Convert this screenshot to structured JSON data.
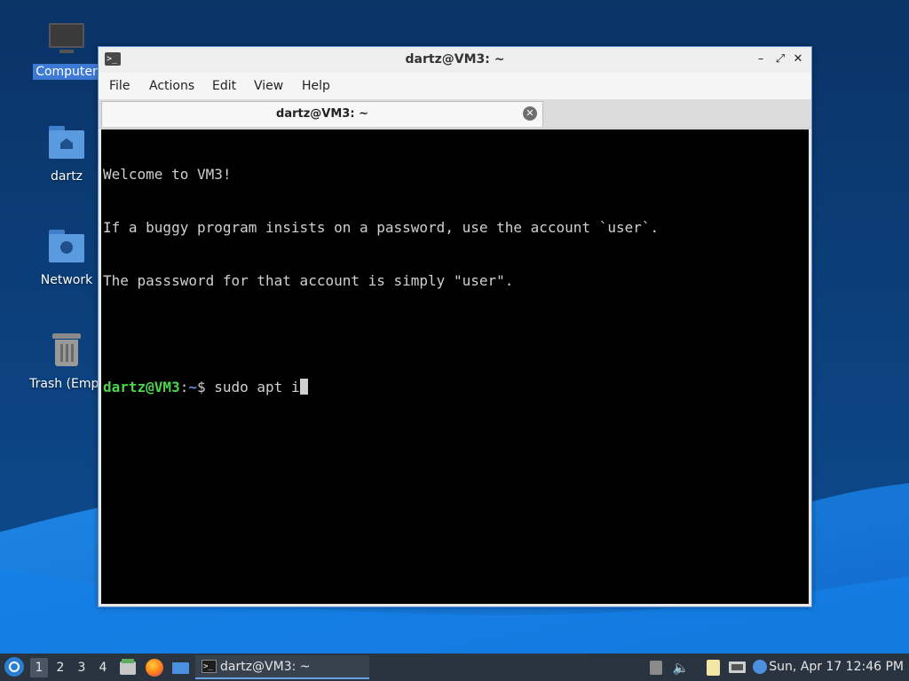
{
  "desktop": {
    "icons": [
      {
        "label": "Computer"
      },
      {
        "label": "dartz"
      },
      {
        "label": "Network"
      },
      {
        "label": "Trash (Empt"
      }
    ]
  },
  "window": {
    "title": "dartz@VM3: ~",
    "controls": {
      "minimize": "–",
      "maximize": "⤢",
      "close": "✕"
    },
    "menu": [
      "File",
      "Actions",
      "Edit",
      "View",
      "Help"
    ],
    "tab": {
      "title": "dartz@VM3: ~"
    },
    "terminal": {
      "lines": [
        "Welcome to VM3!",
        "If a buggy program insists on a password, use the account `user`.",
        "The passsword for that account is simply \"user\"."
      ],
      "prompt": {
        "user_host": "dartz@VM3",
        "sep": ":",
        "path": "~",
        "symbol": "$ "
      },
      "command": "sudo apt i"
    }
  },
  "taskbar": {
    "workspaces": [
      "1",
      "2",
      "3",
      "4"
    ],
    "active_workspace": "1",
    "task_label": "dartz@VM3: ~",
    "clock": "Sun, Apr 17 12:46 PM"
  },
  "colors": {
    "accent": "#5b8fd6",
    "prompt_user": "#4fd44f",
    "taskbar": "#293440"
  }
}
